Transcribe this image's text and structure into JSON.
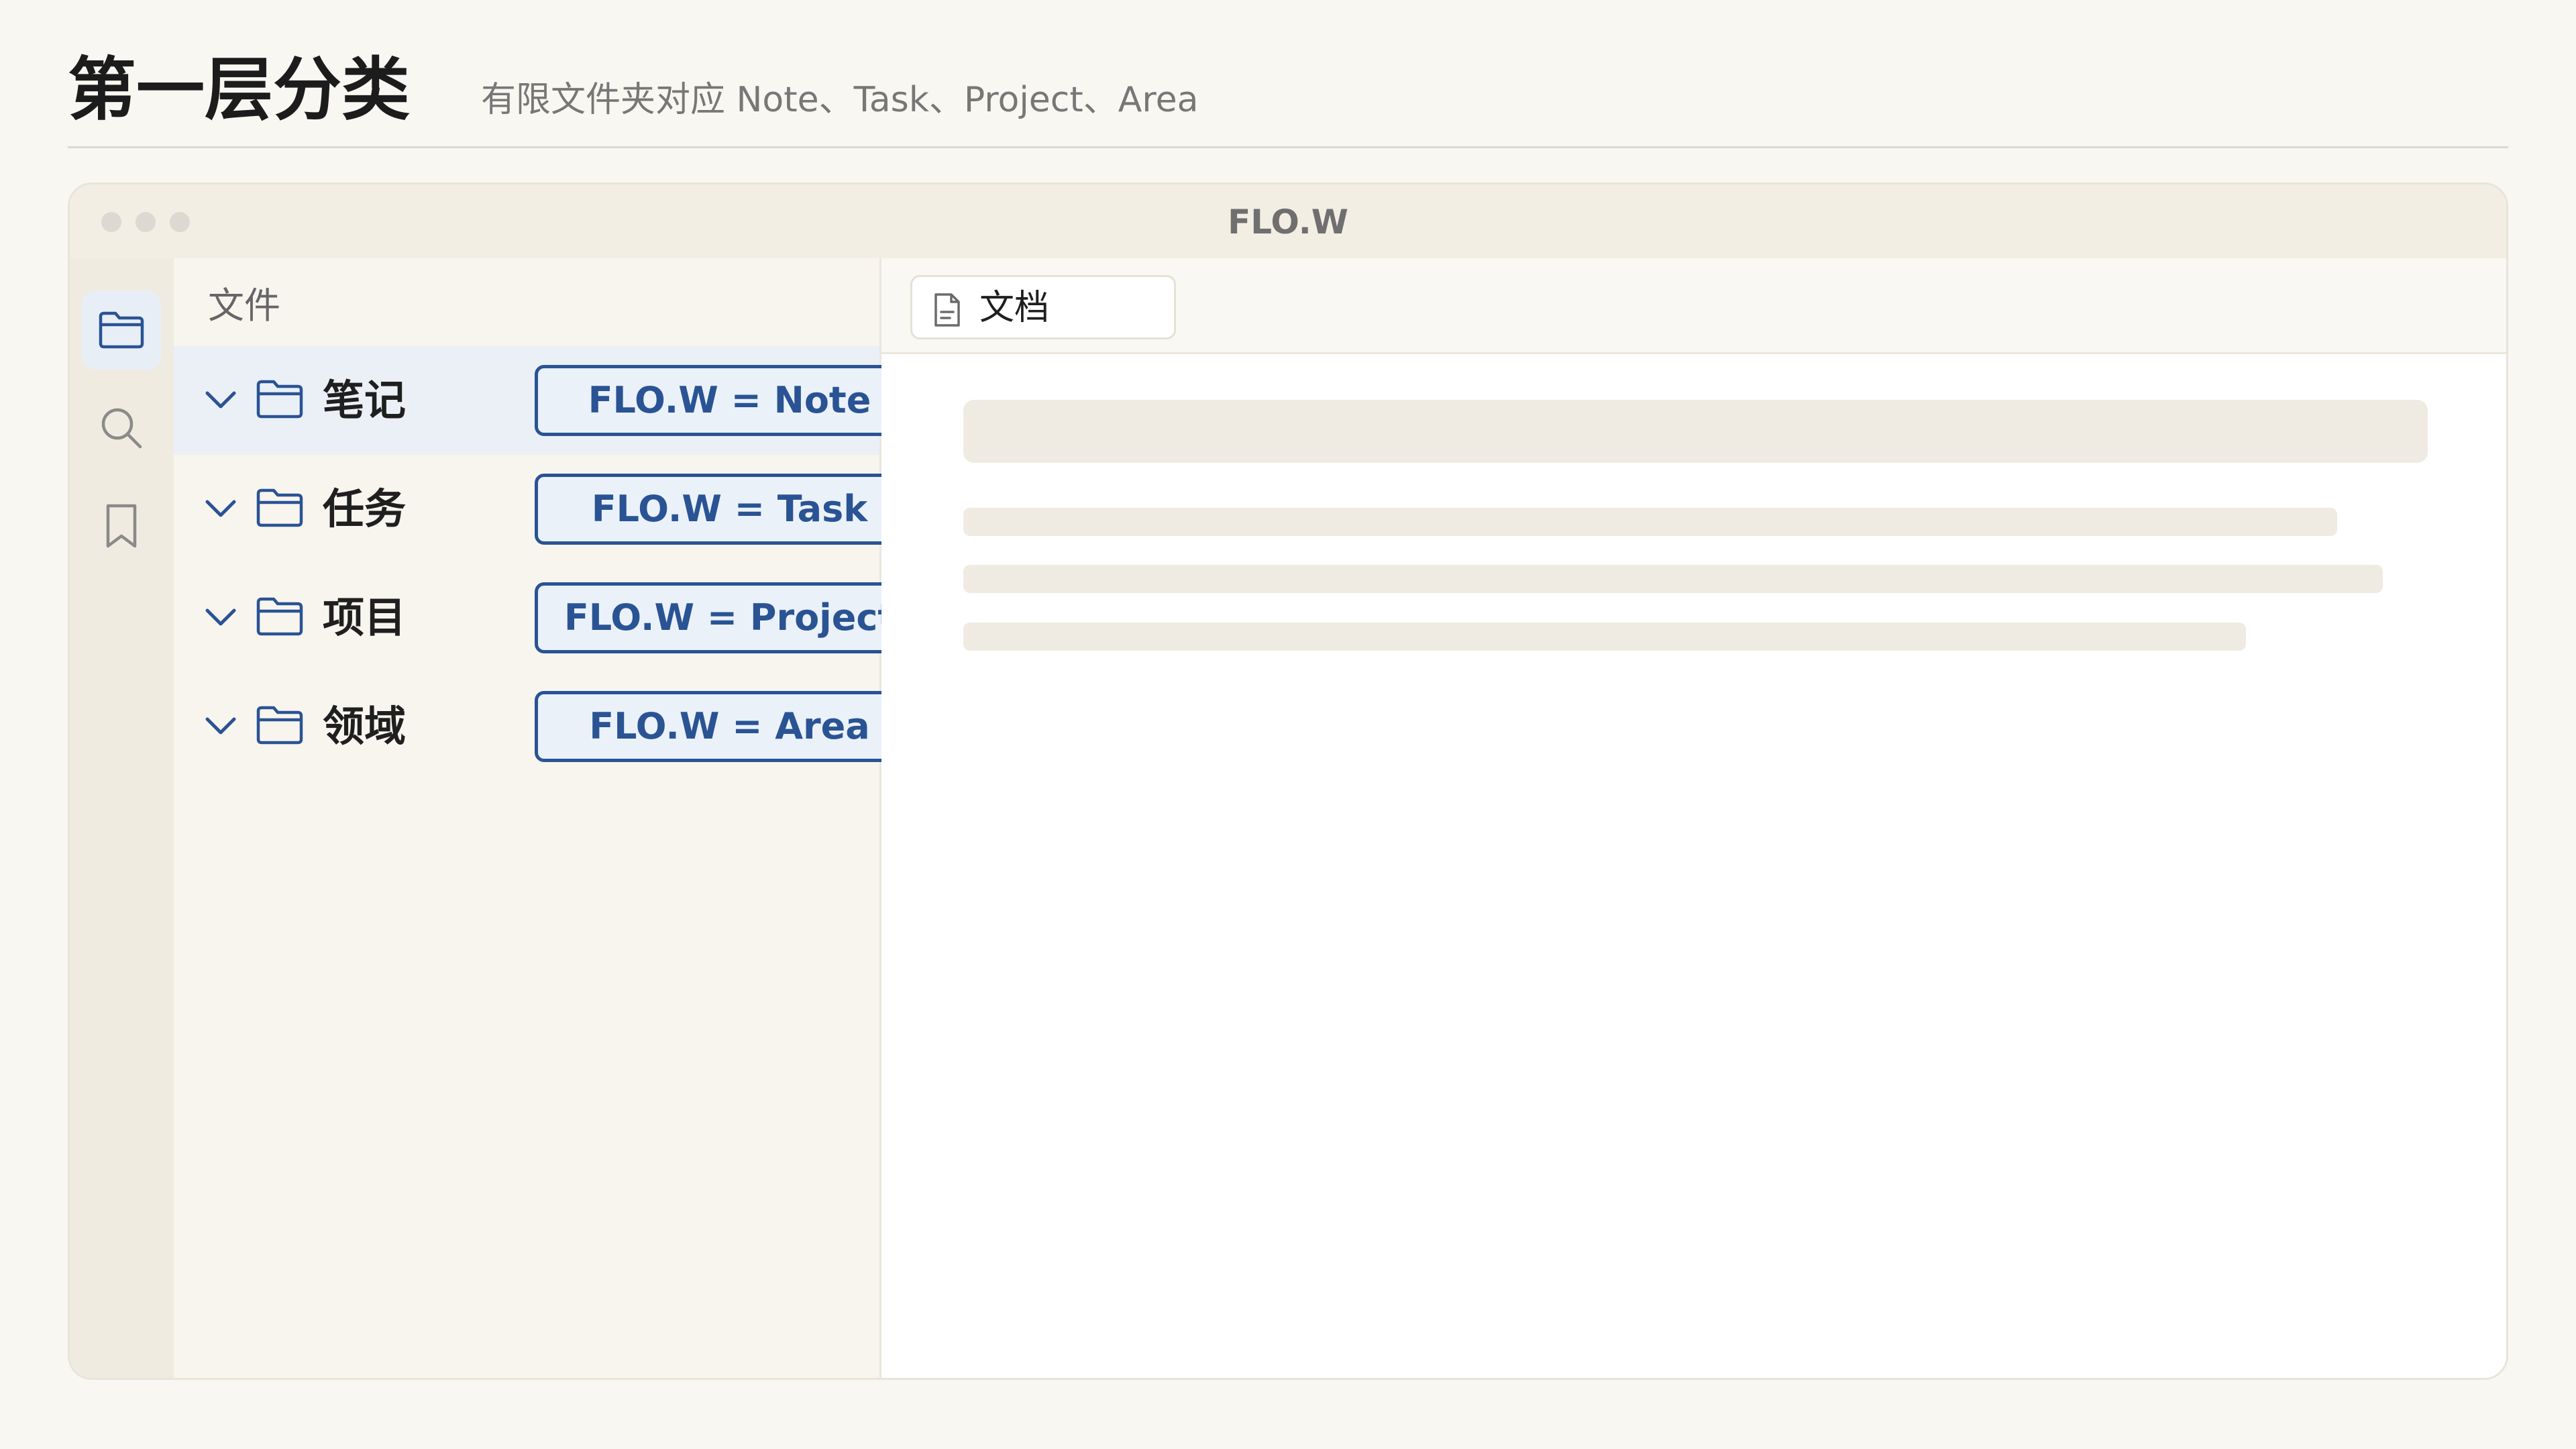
{
  "header": {
    "title": "第一层分类",
    "subtitle": "有限文件夹对应 Note、Task、Project、Area"
  },
  "window": {
    "title": "FLO.W"
  },
  "icon_rail": {
    "items": [
      {
        "icon": "folder-icon",
        "active": true
      },
      {
        "icon": "search-icon",
        "active": false
      },
      {
        "icon": "bookmark-icon",
        "active": false
      }
    ]
  },
  "file_panel": {
    "header": "文件",
    "folders": [
      {
        "label": "笔记",
        "mapping": "FLO.W = Note",
        "selected": true
      },
      {
        "label": "任务",
        "mapping": "FLO.W = Task",
        "selected": false
      },
      {
        "label": "项目",
        "mapping": "FLO.W = Project",
        "selected": false
      },
      {
        "label": "领域",
        "mapping": "FLO.W = Area",
        "selected": false
      }
    ]
  },
  "editor": {
    "tab_label": "文档",
    "tab_icon": "document-icon"
  },
  "colors": {
    "accent": "#2a5394",
    "badge_fill": "#eaf1f8",
    "selected_row": "#eaf0f6",
    "page_background": "#f9f7f1"
  }
}
